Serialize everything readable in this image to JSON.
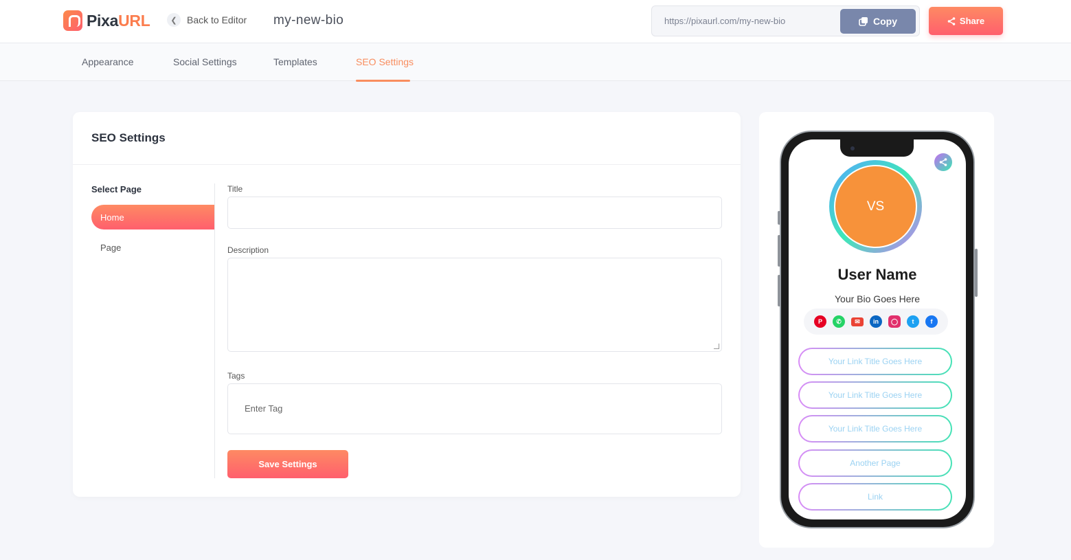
{
  "header": {
    "logo_text_a": "Pixa",
    "logo_text_b": "URL",
    "back_label": "Back to Editor",
    "bio_name": "my-new-bio",
    "url": "https://pixaurl.com/my-new-bio",
    "copy_label": "Copy",
    "share_label": "Share"
  },
  "tabs": [
    {
      "label": "Appearance",
      "active": false
    },
    {
      "label": "Social Settings",
      "active": false
    },
    {
      "label": "Templates",
      "active": false
    },
    {
      "label": "SEO Settings",
      "active": true
    }
  ],
  "seo": {
    "title": "SEO Settings",
    "select_page_title": "Select Page",
    "pages": [
      {
        "label": "Home",
        "selected": true
      },
      {
        "label": "Page",
        "selected": false
      }
    ],
    "fields": {
      "title_label": "Title",
      "title_value": "",
      "description_label": "Description",
      "description_value": "",
      "tags_label": "Tags",
      "tags_placeholder": "Enter Tag"
    },
    "save_label": "Save Settings"
  },
  "preview": {
    "avatar_initials": "VS",
    "user_name": "User Name",
    "bio": "Your Bio Goes Here",
    "social_icons": [
      {
        "name": "pinterest-icon",
        "color": "#e60023"
      },
      {
        "name": "whatsapp-icon",
        "color": "#25d366"
      },
      {
        "name": "email-icon",
        "color": "#ea4335"
      },
      {
        "name": "linkedin-icon",
        "color": "#0a66c2"
      },
      {
        "name": "instagram-icon",
        "color": "#e1306c"
      },
      {
        "name": "twitter-icon",
        "color": "#1da1f2"
      },
      {
        "name": "facebook-icon",
        "color": "#1877f2"
      }
    ],
    "links": [
      "Your Link Title Goes Here",
      "Your Link Title Goes Here",
      "Your Link Title Goes Here",
      "Another Page",
      "Link"
    ]
  },
  "colors": {
    "accent": "#f98d5e",
    "gradient_start": "#fe8a63",
    "gradient_end": "#ff5f6d",
    "avatar": "#f7923a"
  }
}
